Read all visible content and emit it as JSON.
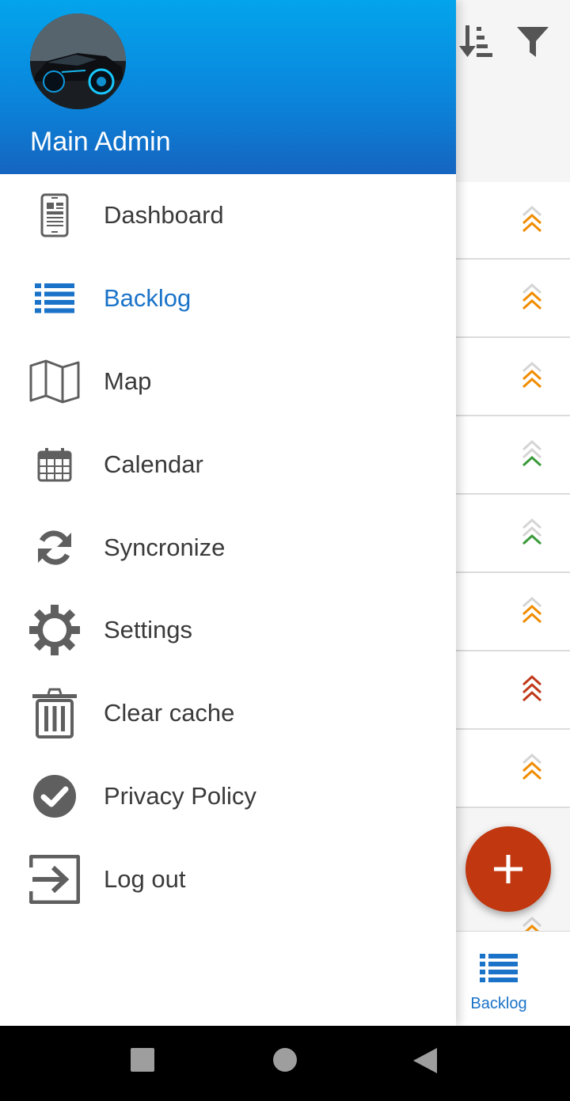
{
  "drawer": {
    "user_name": "Main Admin",
    "avatar_icon": "user-avatar-car-image",
    "header_colors": [
      "#03a4ec",
      "#1565c0"
    ],
    "items": [
      {
        "label": "Dashboard",
        "icon": "dashboard-phone-icon",
        "active": false
      },
      {
        "label": "Backlog",
        "icon": "list-icon",
        "active": true
      },
      {
        "label": "Map",
        "icon": "map-icon",
        "active": false
      },
      {
        "label": "Calendar",
        "icon": "calendar-icon",
        "active": false
      },
      {
        "label": "Syncronize",
        "icon": "sync-icon",
        "active": false
      },
      {
        "label": "Settings",
        "icon": "gear-icon",
        "active": false
      },
      {
        "label": "Clear cache",
        "icon": "trash-icon",
        "active": false
      },
      {
        "label": "Privacy Policy",
        "icon": "check-circle-icon",
        "active": false
      },
      {
        "label": "Log out",
        "icon": "logout-icon",
        "active": false
      }
    ]
  },
  "toolbar": {
    "icons": [
      "sort-icon",
      "filter-icon"
    ]
  },
  "backlog_rows": [
    {
      "priority": "high",
      "color": "#f08c00"
    },
    {
      "priority": "high",
      "color": "#f08c00"
    },
    {
      "priority": "high",
      "color": "#f08c00"
    },
    {
      "priority": "low",
      "color": "#3a9a3a"
    },
    {
      "priority": "low",
      "color": "#3a9a3a"
    },
    {
      "priority": "high",
      "color": "#f08c00"
    },
    {
      "priority": "highest",
      "color": "#c0391a"
    },
    {
      "priority": "high",
      "color": "#f08c00"
    }
  ],
  "fab": {
    "icon": "plus-icon",
    "color": "#c1370f"
  },
  "bottom_nav": {
    "label": "Backlog",
    "icon": "list-icon",
    "color": "#1a73c8"
  },
  "system_nav": {
    "icons": [
      "recent-apps-icon",
      "home-icon",
      "back-icon"
    ]
  },
  "colors": {
    "accent": "#1a73c8",
    "text": "#3a3a3a",
    "icon": "#5f5f5f"
  }
}
